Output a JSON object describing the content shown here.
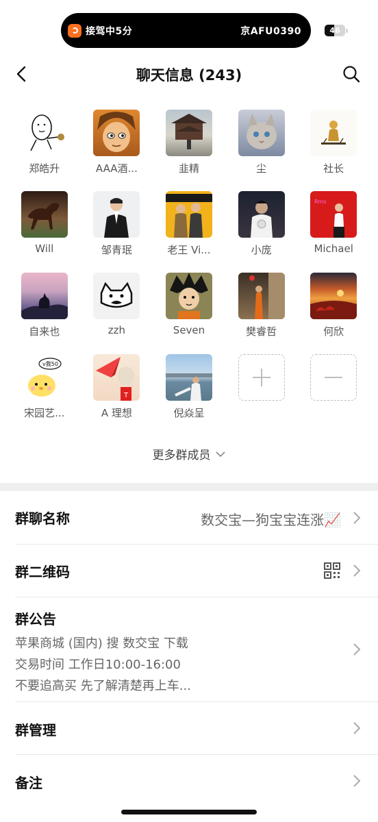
{
  "status": {
    "ride_text": "接驾中5分",
    "plate": "京AFU0390",
    "battery": "46"
  },
  "nav": {
    "title": "聊天信息 (243)"
  },
  "members": [
    {
      "name": "郑皓升"
    },
    {
      "name": "AAA酒..."
    },
    {
      "name": "韭精"
    },
    {
      "name": "尘"
    },
    {
      "name": "社长"
    },
    {
      "name": "Will"
    },
    {
      "name": "邹青珉"
    },
    {
      "name": "老王 Vi..."
    },
    {
      "name": "小庞"
    },
    {
      "name": "Michael"
    },
    {
      "name": "自来也"
    },
    {
      "name": "zzh"
    },
    {
      "name": "Seven"
    },
    {
      "name": "樊睿哲"
    },
    {
      "name": "何欣"
    },
    {
      "name": "宋园艺..."
    },
    {
      "name": "A 理想"
    },
    {
      "name": "倪焱呈"
    }
  ],
  "more_members": "更多群成员",
  "settings": {
    "group_name_label": "群聊名称",
    "group_name_value": "数交宝—狗宝宝连涨📈",
    "qr_label": "群二维码",
    "notice_label": "群公告",
    "notice_lines": [
      "苹果商城 (国内) 搜 数交宝 下载",
      "交易时间 工作日10:00-16:00",
      "不要追高买 先了解清楚再上车..."
    ],
    "manage_label": "群管理",
    "remark_label": "备注"
  }
}
